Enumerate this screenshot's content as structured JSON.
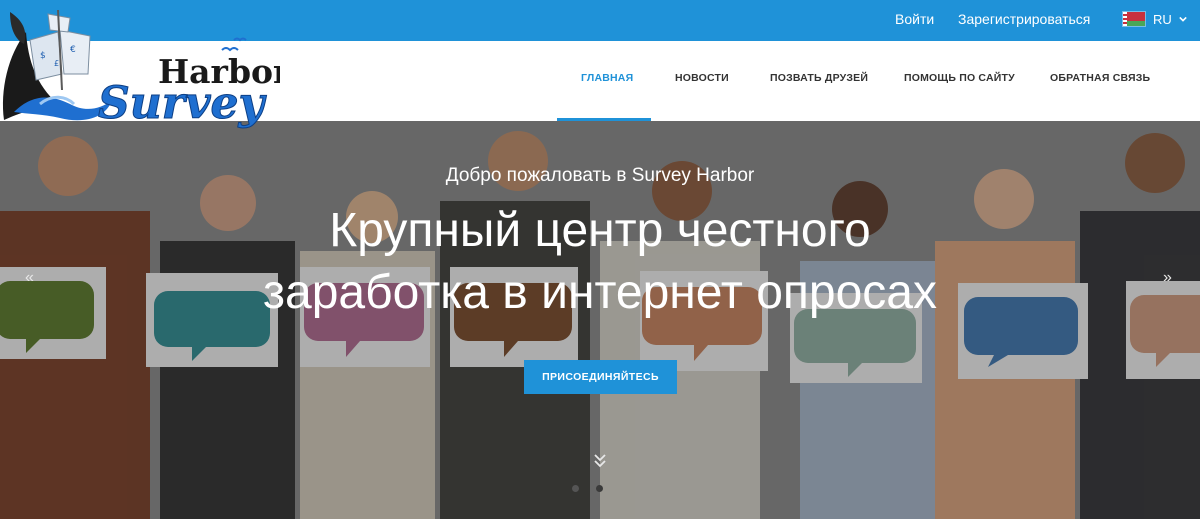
{
  "topbar": {
    "login": "Войти",
    "register": "Зарегистрироваться",
    "language": "RU",
    "language_flag_icon": "belarus-flag-icon",
    "language_chevron_icon": "chevron-down-icon"
  },
  "logo": {
    "word1": "Harbor",
    "word2": "Survey",
    "icon": "ship-logo-icon"
  },
  "nav": {
    "items": [
      {
        "label": "ГЛАВНАЯ",
        "active": true
      },
      {
        "label": "НОВОСТИ",
        "active": false
      },
      {
        "label": "ПОЗВАТЬ ДРУЗЕЙ",
        "active": false
      },
      {
        "label": "ПОМОЩЬ ПО САЙТУ",
        "active": false
      },
      {
        "label": "ОБРАТНАЯ СВЯЗЬ",
        "active": false
      }
    ]
  },
  "hero": {
    "welcome_prefix": "Добро пожаловать в",
    "welcome_brand": "Survey Harbor",
    "headline_line1": "Крупный центр честного",
    "headline_line2": "заработка в интернет опросах",
    "cta_label": "ПРИСОЕДИНЯЙТЕСЬ",
    "prev_arrow": "«",
    "next_arrow": "»",
    "scroll_icon": "double-chevron-down-icon",
    "slide_count": 2,
    "active_slide": 1
  },
  "colors": {
    "primary": "#1f92d8",
    "nav_text": "#333333",
    "white": "#ffffff"
  }
}
